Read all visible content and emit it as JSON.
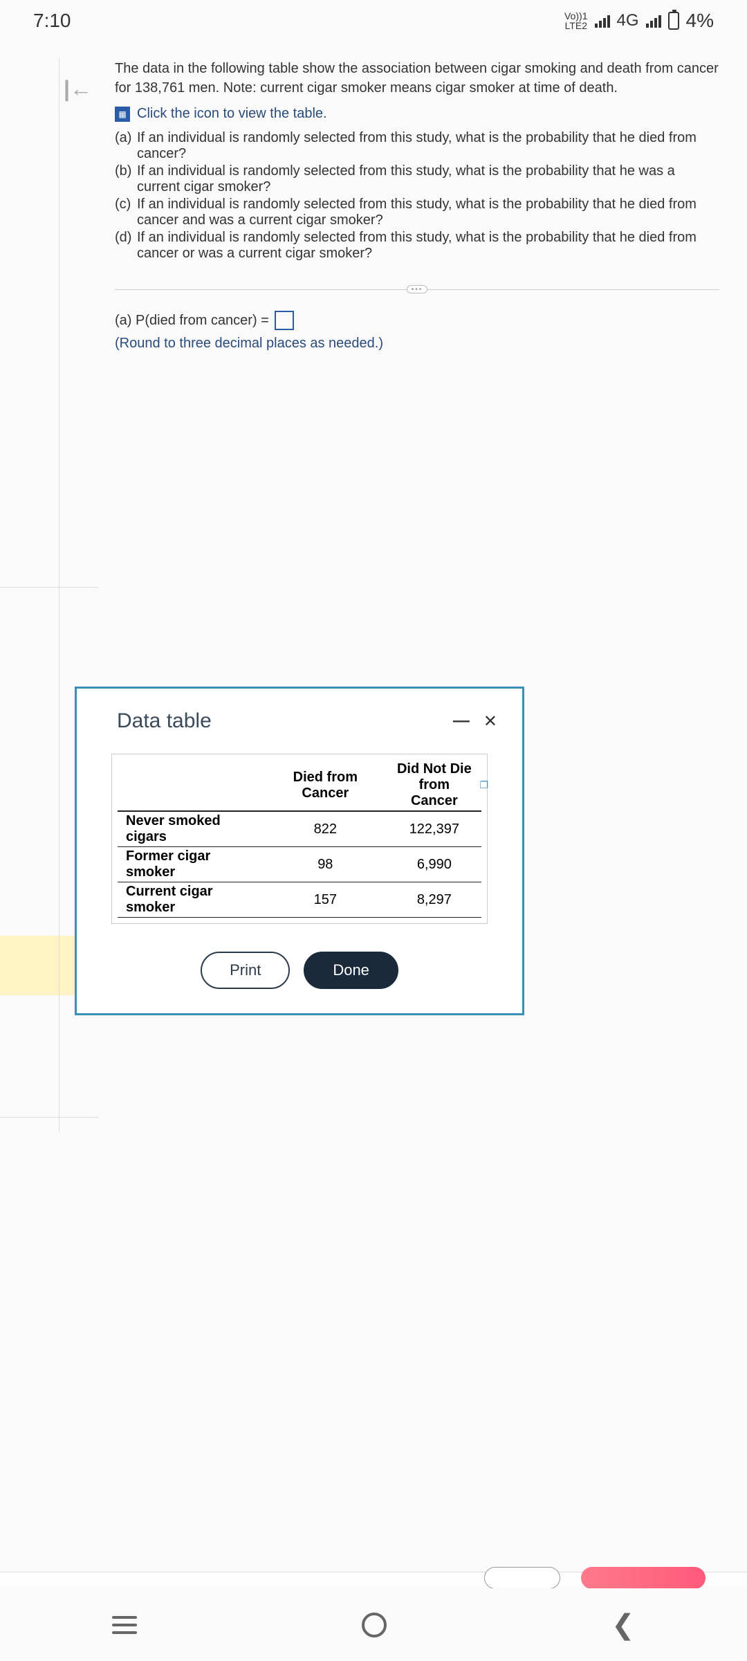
{
  "status": {
    "time": "7:10",
    "vol_top": "Vo))1",
    "vol_bottom": "LTE2",
    "net": "4G",
    "battery": "4%"
  },
  "question": {
    "intro": "The data in the following table show the association between cigar smoking and death from cancer for 138,761 men. Note: current cigar smoker means cigar smoker at time of death.",
    "link_text": "Click the icon to view the table.",
    "parts": {
      "a": "If an individual is randomly selected from this study, what is the probability that he died from cancer?",
      "b": "If an individual is randomly selected from this study, what is the probability that he was a current cigar smoker?",
      "c": "If an individual is randomly selected from this study, what is the probability that he died from cancer and was a current cigar smoker?",
      "d": "If an individual is randomly selected from this study, what is the probability that he died from cancer or was a current cigar smoker?"
    },
    "answer_prefix": "(a) P(died from cancer) =",
    "round_note": "(Round to three decimal places as needed.)"
  },
  "modal": {
    "title": "Data table",
    "headers": {
      "c1": "",
      "c2": "Died from Cancer",
      "c3_l1": "Did Not Die",
      "c3_l2": "from Cancer"
    },
    "rows": [
      {
        "label": "Never smoked cigars",
        "died": "822",
        "not": "122,397"
      },
      {
        "label": "Former cigar smoker",
        "died": "98",
        "not": "6,990"
      },
      {
        "label": "Current cigar smoker",
        "died": "157",
        "not": "8,297"
      }
    ],
    "print": "Print",
    "done": "Done"
  },
  "chart_data": {
    "type": "table",
    "columns": [
      "",
      "Died from Cancer",
      "Did Not Die from Cancer"
    ],
    "rows": [
      [
        "Never smoked cigars",
        822,
        122397
      ],
      [
        "Former cigar smoker",
        98,
        6990
      ],
      [
        "Current cigar smoker",
        157,
        8297
      ]
    ]
  }
}
